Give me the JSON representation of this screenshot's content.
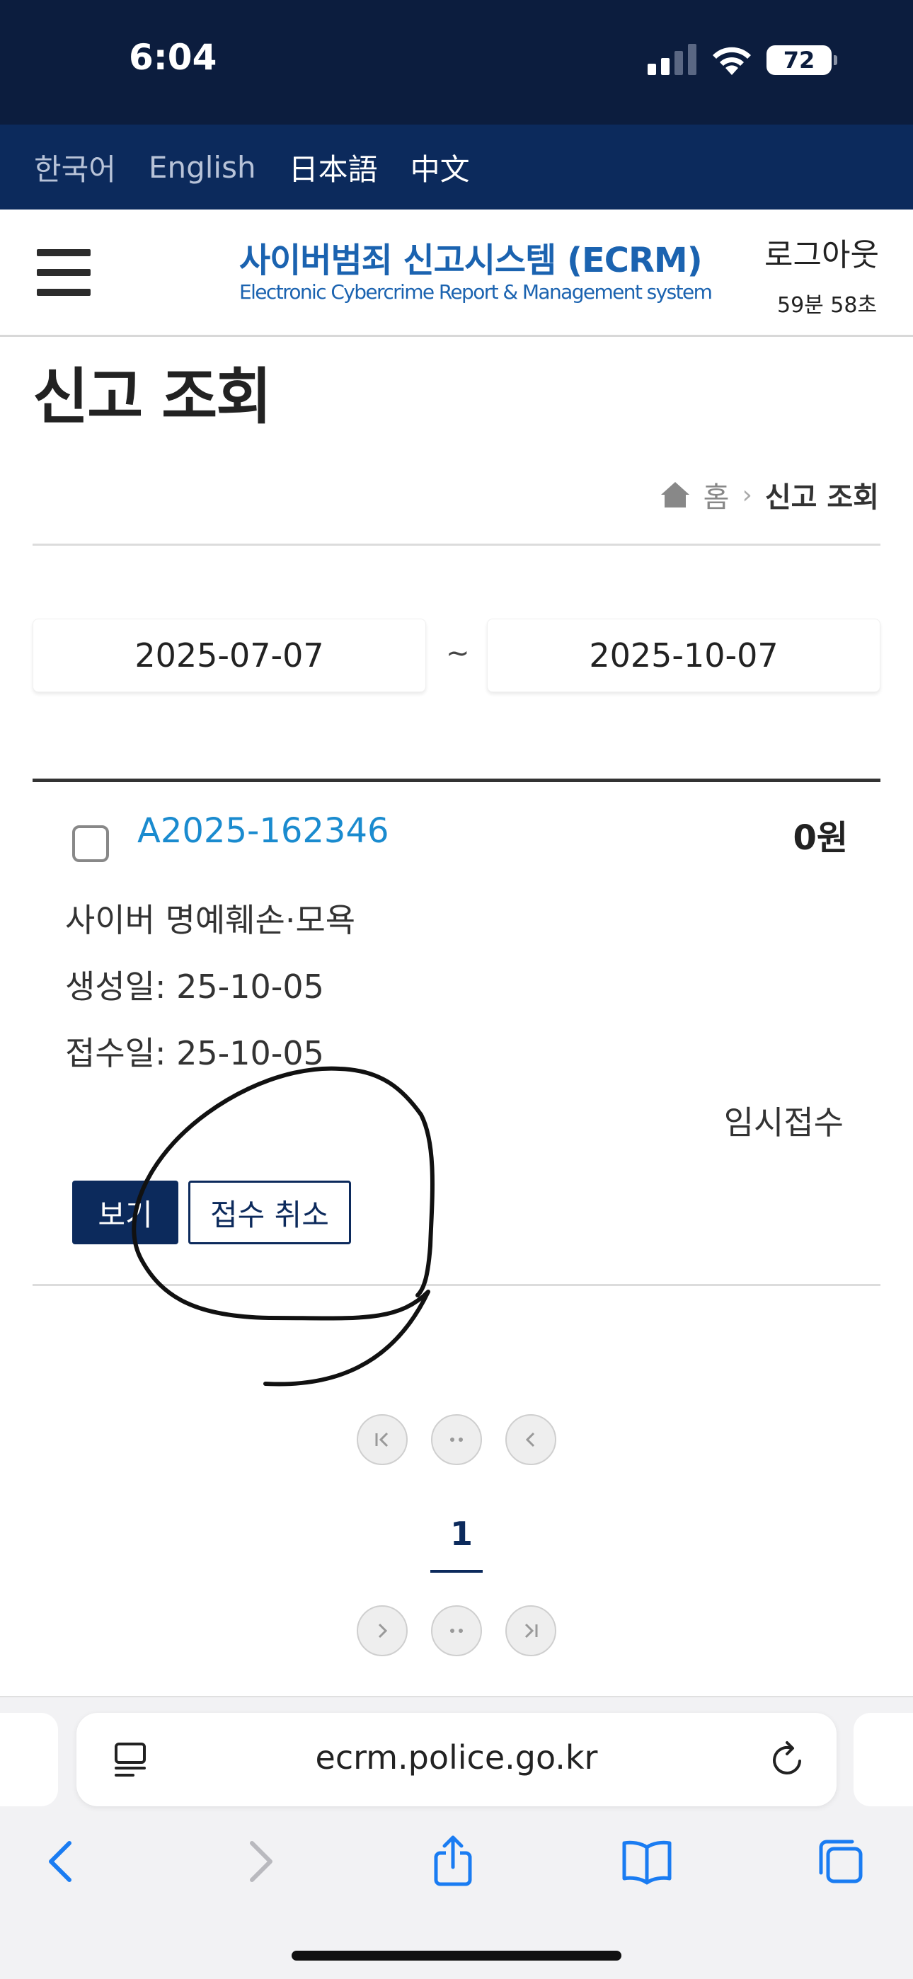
{
  "status_bar": {
    "time": "6:04",
    "battery": "72"
  },
  "languages": [
    "한국어",
    "English",
    "日本語",
    "中文"
  ],
  "header": {
    "title": "사이버범죄 신고시스템 (ECRM)",
    "subtitle": "Electronic Cybercrime Report & Management system",
    "logout": "로그아웃",
    "session_timer": "59분 58초"
  },
  "page": {
    "title": "신고 조회"
  },
  "breadcrumb": {
    "home": "홈",
    "separator": "›",
    "current": "신고 조회"
  },
  "date_range": {
    "from": "2025-07-07",
    "separator": "~",
    "to": "2025-10-07"
  },
  "report": {
    "id": "A2025-162346",
    "amount": "0원",
    "type": "사이버 명예훼손·모욕",
    "created": "생성일: 25-10-05",
    "received": "접수일: 25-10-05",
    "status": "임시접수",
    "view_button": "보기",
    "cancel_button": "접수 취소"
  },
  "pagination": {
    "current_page": "1"
  },
  "browser": {
    "url": "ecrm.police.go.kr"
  },
  "colors": {
    "status_bar": "#0c1d3e",
    "language_bar": "#0c2a5c",
    "brand_blue": "#1b63b0",
    "link_blue": "#1a8bcf",
    "button_navy": "#0c2a5c",
    "ios_blue": "#1a7cf2"
  },
  "icons": {
    "signal": "cellular-signal-icon",
    "wifi": "wifi-icon",
    "menu": "hamburger-menu-icon",
    "home": "home-icon",
    "first": "first-page-icon",
    "prev_group": "previous-group-icon",
    "prev": "previous-page-icon",
    "next": "next-page-icon",
    "next_group": "next-group-icon",
    "last": "last-page-icon",
    "reader": "reader-mode-icon",
    "reload": "reload-icon",
    "back": "back-icon",
    "forward": "forward-icon",
    "share": "share-icon",
    "bookmarks": "bookmarks-icon",
    "tabs": "tabs-icon"
  }
}
